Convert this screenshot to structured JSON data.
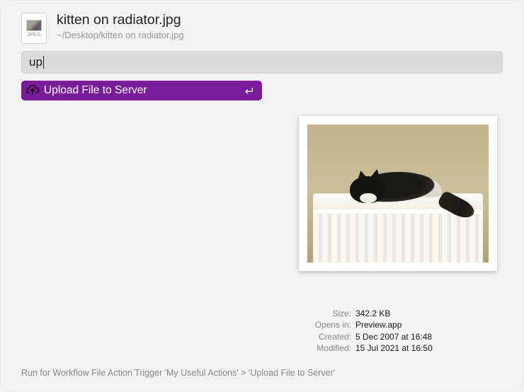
{
  "header": {
    "filename": "kitten on radiator.jpg",
    "filepath": "~/Desktop/kitten on radiator.jpg",
    "file_badge": "JPEG"
  },
  "search": {
    "value": "up"
  },
  "result": {
    "label": "Upload File to Server",
    "icon": "cloud-upload-icon"
  },
  "metadata": {
    "size_label": "Size:",
    "size_value": "342.2 KB",
    "opens_label": "Opens in:",
    "opens_value": "Preview.app",
    "created_label": "Created:",
    "created_value": "5 Dec 2007 at 16:48",
    "modified_label": "Modified:",
    "modified_value": "15 Jul 2021 at 16:50"
  },
  "footer": {
    "text": "Run for Workflow File Action Trigger 'My Useful Actions' > 'Upload File to Server'"
  }
}
